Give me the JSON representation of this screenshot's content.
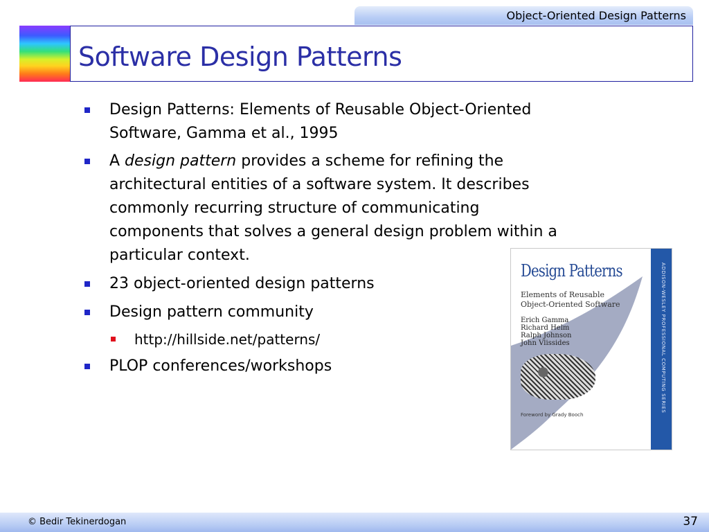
{
  "header": {
    "course_title": "Object-Oriented Design Patterns",
    "slide_title": "Software Design Patterns"
  },
  "bullets": [
    {
      "text": "Design Patterns: Elements of Reusable Object-Oriented Software, Gamma et al., 1995"
    },
    {
      "prefix": "A ",
      "emphasis": "design pattern",
      "suffix": " provides a scheme for refining the architectural entities of a software system. It describes commonly recurring structure of communicating components that solves a general design problem within a particular context."
    },
    {
      "text": "23 object-oriented design patterns"
    },
    {
      "text": "Design pattern community"
    },
    {
      "text": "PLOP conferences/workshops"
    }
  ],
  "sub_bullets": [
    {
      "text": "http://hillside.net/patterns/"
    }
  ],
  "book": {
    "title": "Design Patterns",
    "subtitle_line1": "Elements of Reusable",
    "subtitle_line2": "Object-Oriented Software",
    "authors": [
      "Erich Gamma",
      "Richard Helm",
      "Ralph Johnson",
      "John Vlissides"
    ],
    "foreword": "Foreword by Grady Booch",
    "series": "ADDISON-WESLEY PROFESSIONAL COMPUTING SERIES"
  },
  "footer": {
    "author": "© Bedir Tekinerdogan",
    "page_number": "37"
  }
}
